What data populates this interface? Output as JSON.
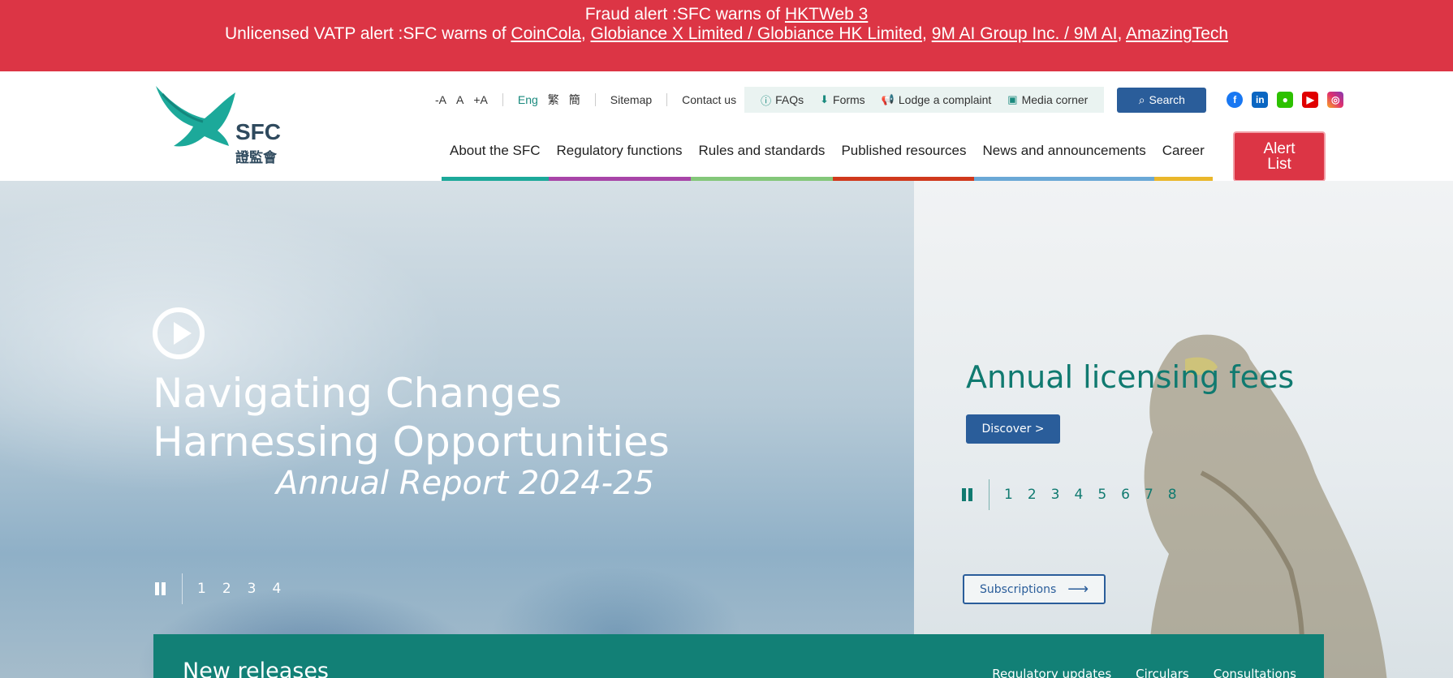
{
  "alerts": {
    "fraud": {
      "label": "Fraud alert :",
      "text": "SFC warns of ",
      "links": [
        "HKTWeb 3"
      ]
    },
    "vatp": {
      "label": "Unlicensed VATP alert :",
      "text": "SFC warns of ",
      "links": [
        "CoinCola",
        "Globiance X Limited / Globiance HK Limited",
        "9M AI Group Inc. / 9M AI",
        "AmazingTech"
      ]
    }
  },
  "logo": {
    "text": "SFC",
    "chinese": "證監會"
  },
  "utility": {
    "font_smaller": "-A",
    "font_normal": "A",
    "font_larger": "+A",
    "lang_eng": "Eng",
    "lang_trad": "繁",
    "lang_simp": "簡",
    "sitemap": "Sitemap",
    "contact": "Contact us"
  },
  "quick_links": {
    "faqs": "FAQs",
    "forms": "Forms",
    "complaint": "Lodge a complaint",
    "media": "Media corner"
  },
  "search": {
    "label": "Search"
  },
  "nav": [
    {
      "label": "About the SFC",
      "color": "#1ca99a"
    },
    {
      "label": "Regulatory functions",
      "color": "#a845a8"
    },
    {
      "label": "Rules and standards",
      "color": "#84c77a"
    },
    {
      "label": "Published resources",
      "color": "#d0391c"
    },
    {
      "label": "News and announcements",
      "color": "#6aa8d6"
    },
    {
      "label": "Career",
      "color": "#eab72b"
    }
  ],
  "alert_list": {
    "line1": "Alert",
    "line2": "List"
  },
  "hero_left": {
    "title_line1": "Navigating Changes",
    "title_line2": "Harnessing Opportunities",
    "subtitle": "Annual Report 2024-25",
    "pages": [
      "1",
      "2",
      "3",
      "4"
    ]
  },
  "hero_right": {
    "title": "Annual licensing fees",
    "discover": "Discover >",
    "pages": [
      "1",
      "2",
      "3",
      "4",
      "5",
      "6",
      "7",
      "8"
    ]
  },
  "subscriptions": {
    "label": "Subscriptions",
    "arrow": "⟶"
  },
  "new_releases": {
    "title": "New releases",
    "tabs": [
      "Regulatory updates",
      "Circulars",
      "Consultations"
    ]
  },
  "colors": {
    "alert_red": "#dc3545",
    "brand_teal": "#128076",
    "button_blue": "#2a5d9a"
  }
}
